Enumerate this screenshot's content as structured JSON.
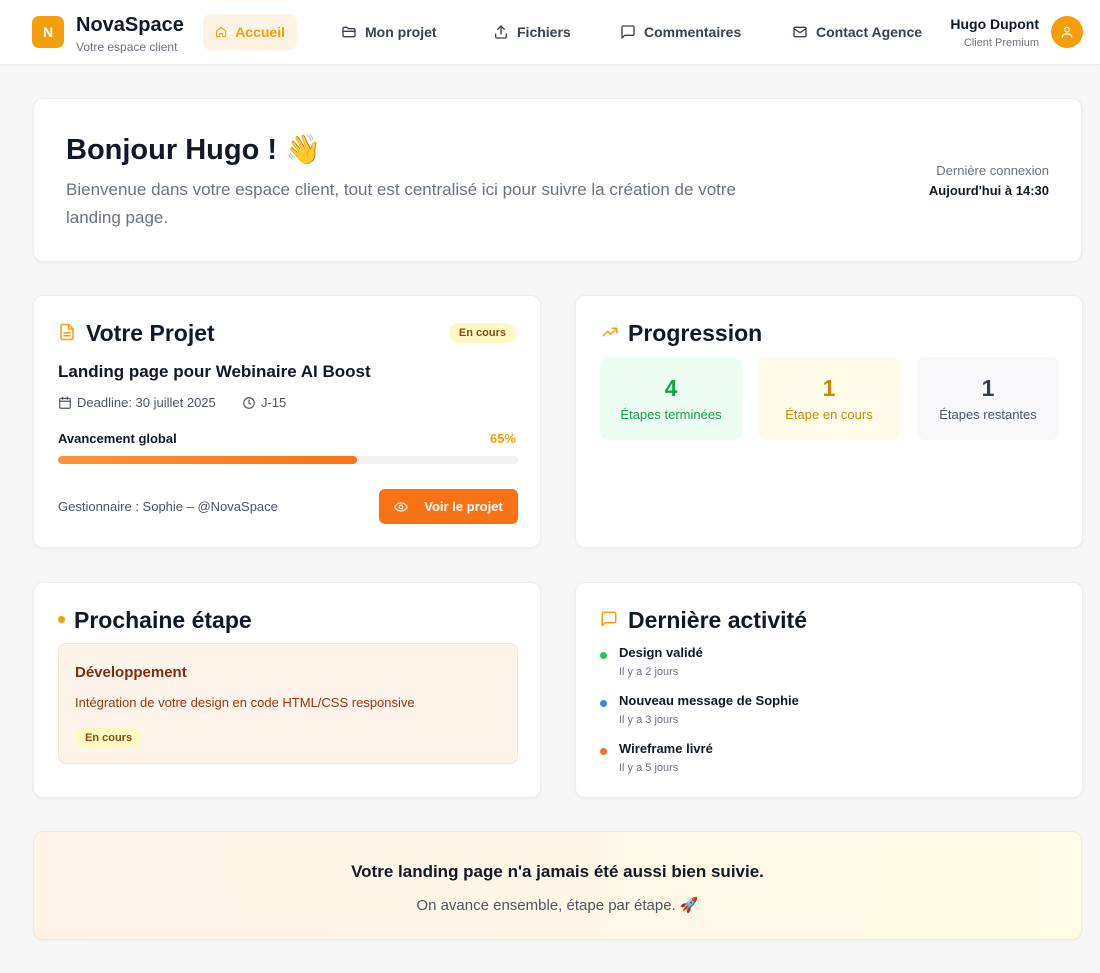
{
  "brand": {
    "logo_letter": "N",
    "name": "NovaSpace",
    "subtitle": "Votre espace client"
  },
  "nav": [
    {
      "label": "Accueil",
      "icon": "home-icon",
      "active": true
    },
    {
      "label": "Mon projet",
      "icon": "folder-icon"
    },
    {
      "label": "Fichiers",
      "icon": "upload-icon"
    },
    {
      "label": "Commentaires",
      "icon": "message-icon"
    },
    {
      "label": "Contact Agence",
      "icon": "mail-icon"
    }
  ],
  "user": {
    "name": "Hugo Dupont",
    "role": "Client Premium"
  },
  "welcome": {
    "title": "Bonjour Hugo ! 👋",
    "text": "Bienvenue dans votre espace client, tout est centralisé ici pour suivre la création de votre landing page.",
    "last_login_label": "Dernière connexion",
    "last_login_value": "Aujourd'hui à 14:30"
  },
  "project": {
    "title": "Votre Projet",
    "status": "En cours",
    "name": "Landing page pour Webinaire AI Boost",
    "deadline": "Deadline: 30 juillet 2025",
    "countdown": "J-15",
    "progress_label": "Avancement global",
    "progress_text": "65%",
    "progress_value": 0.65,
    "manager": "Gestionnaire : Sophie – @NovaSpace",
    "button": "Voir le projet"
  },
  "progression": {
    "title": "Progression",
    "stats": [
      {
        "value": "4",
        "label": "Étapes terminées"
      },
      {
        "value": "1",
        "label": "Étape en cours"
      },
      {
        "value": "1",
        "label": "Étapes restantes"
      }
    ]
  },
  "next_step": {
    "title": "Prochaine étape",
    "step_title": "Développement",
    "description": "Intégration de votre design en code HTML/CSS responsive",
    "status": "En cours"
  },
  "activity": {
    "title": "Dernière activité",
    "items": [
      {
        "title": "Design validé",
        "time": "Il y a 2 jours",
        "color": "#22c55e"
      },
      {
        "title": "Nouveau message de Sophie",
        "time": "Il y a 3 jours",
        "color": "#3b82f6"
      },
      {
        "title": "Wireframe livré",
        "time": "Il y a 5 jours",
        "color": "#f97316"
      }
    ]
  },
  "banner": {
    "title": "Votre landing page n'a jamais été aussi bien suivie.",
    "subtitle": "On avance ensemble, étape par étape. 🚀"
  },
  "colors": {
    "accent": "#f59e0b",
    "accent_dark": "#f97316"
  }
}
